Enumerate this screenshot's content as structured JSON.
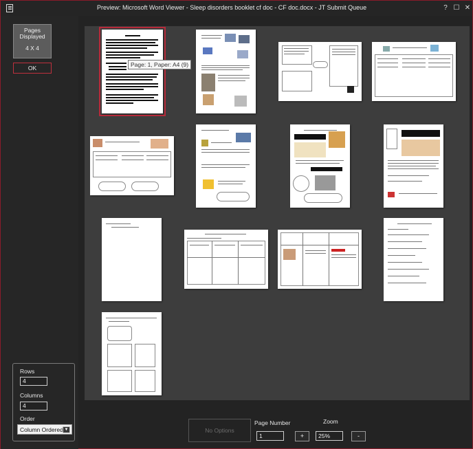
{
  "window": {
    "title": "Preview:  Microsoft Word Viewer - Sleep disorders booklet cf doc - CF doc.docx  -  JT Submit Queue",
    "buttons": {
      "help": "?",
      "maximize": "☐",
      "close": "✕"
    },
    "border_color": "#8a1b2a"
  },
  "left_panel": {
    "pages_displayed": {
      "label": "Pages Displayed",
      "value": "4 X 4"
    },
    "ok_label": "OK",
    "rows_label": "Rows",
    "rows_value": "4",
    "columns_label": "Columns",
    "columns_value": "4",
    "order_label": "Order",
    "order_value": "Column Ordered"
  },
  "preview": {
    "tooltip": "Page: 1, Paper: A4 (9)",
    "selected_page": 1,
    "page_count": 13,
    "accent_color": "#b62a3a"
  },
  "bottom": {
    "no_options_label": "No Options",
    "page_number_label": "Page Number",
    "page_number_value": "1",
    "zoom_label": "Zoom",
    "zoom_value": "25%",
    "zoom_in_label": "+",
    "zoom_out_label": "-"
  }
}
